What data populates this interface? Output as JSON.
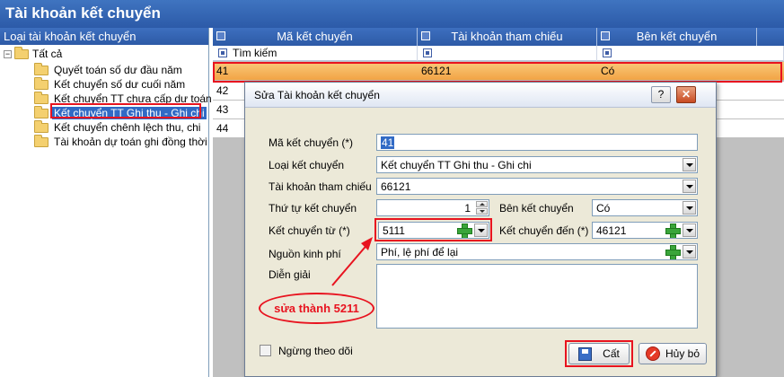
{
  "app": {
    "title": "Tài khoản kết chuyển"
  },
  "sidebar": {
    "header": "Loại tài khoản kết chuyển",
    "root": {
      "expander": "−",
      "label": "Tất cả"
    },
    "items": [
      {
        "label": "Quyết toán số dư đầu năm"
      },
      {
        "label": "Kết chuyển số dư cuối năm"
      },
      {
        "label": "Kết chuyển TT chưa cấp dự toán"
      },
      {
        "label": "Kết chuyển TT Ghi thu - Ghi chi"
      },
      {
        "label": "Kết chuyển chênh lệch thu, chi"
      },
      {
        "label": "Tài khoản dự toán ghi đồng thời"
      }
    ]
  },
  "grid": {
    "columns": [
      "Mã kết chuyển",
      "Tài khoản tham chiếu",
      "Bên kết chuyển"
    ],
    "filter_placeholder": "Tìm kiếm",
    "rows": [
      {
        "code": "41",
        "account": "66121",
        "side": "Có"
      },
      {
        "code": "42",
        "account": "",
        "side": ""
      },
      {
        "code": "43",
        "account": "",
        "side": ""
      },
      {
        "code": "44",
        "account": "",
        "side": ""
      }
    ]
  },
  "dialog": {
    "title": "Sửa Tài khoản kết chuyển",
    "help_label": "?",
    "close_label": "✕",
    "fields": {
      "code_label": "Mã kết chuyển (*)",
      "code_value": "41",
      "type_label": "Loại kết chuyển",
      "type_value": "Kết chuyển TT Ghi thu - Ghi chi",
      "ref_label": "Tài khoản tham chiếu",
      "ref_value": "66121",
      "order_label": "Thứ tự kết chuyển",
      "order_value": "1",
      "side_label": "Bên kết chuyển",
      "side_value": "Có",
      "from_label": "Kết chuyển từ (*)",
      "from_value": "5111",
      "to_label": "Kết chuyển đến (*)",
      "to_value": "46121",
      "fund_label": "Nguồn kinh phí",
      "fund_value": "Phí, lệ phí để lại",
      "desc_label": "Diễn giải"
    },
    "checkbox_label": "Ngừng theo dõi",
    "save_label": "Cất",
    "cancel_label": "Hủy bỏ"
  },
  "annotation": {
    "text": "sửa thành 5211",
    "color": "#e8131f"
  }
}
